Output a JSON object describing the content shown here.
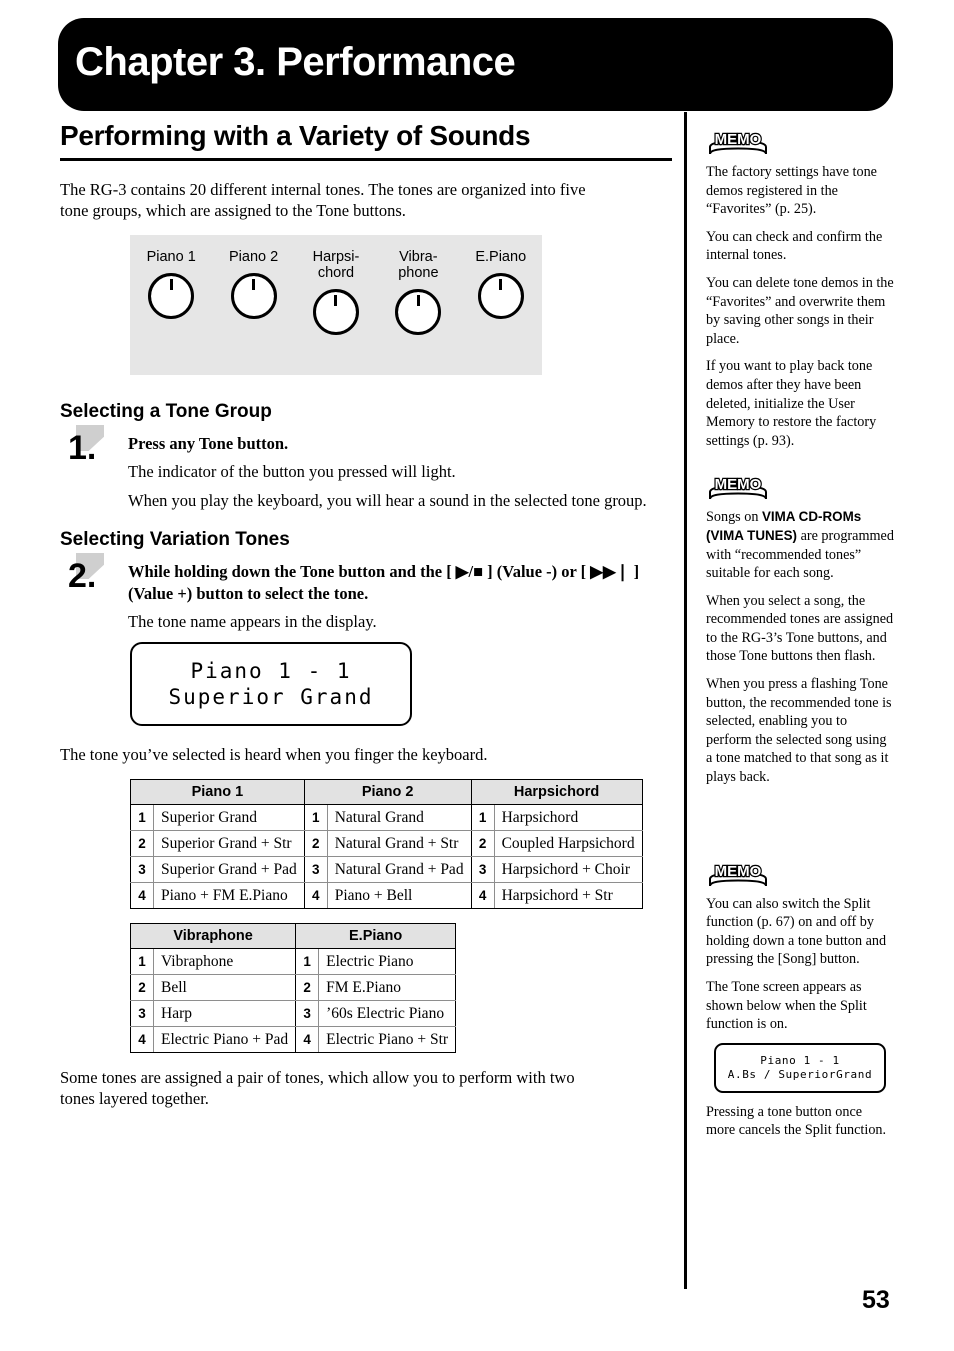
{
  "chapter": {
    "title": "Chapter 3. Performance"
  },
  "section": {
    "title": "Performing with a Variety of Sounds",
    "intro": "The RG-3 contains 20 different internal tones. The tones are organized into five tone groups, which are assigned to the Tone buttons."
  },
  "panel": {
    "buttons": [
      {
        "label": "Piano 1"
      },
      {
        "label": "Piano 2"
      },
      {
        "label": "Harpsi-\nchord"
      },
      {
        "label": "Vibra-\nphone"
      },
      {
        "label": "E.Piano"
      }
    ]
  },
  "subsections": {
    "tone_group": {
      "title": "Selecting a Tone Group"
    },
    "variation": {
      "title": "Selecting Variation Tones"
    }
  },
  "steps": [
    {
      "num": "1.",
      "head": "Press any Tone button.",
      "lines": [
        "The indicator of the button you pressed will light.",
        "When you play the keyboard, you will hear a sound in the selected tone group."
      ]
    },
    {
      "num": "2.",
      "head": "While holding down the Tone button and the [ ▶/■ ] (Value -) or [ ▶▶❘ ] (Value +) button to select the tone.",
      "lines": [
        "The tone name appears in the display."
      ]
    }
  ],
  "lcd_main": {
    "line1": "Piano 1 - 1",
    "line2": "Superior Grand"
  },
  "after_lcd_text": "The tone you’ve selected is heard when you finger the keyboard.",
  "tables": [
    {
      "columns": [
        {
          "header": "Piano 1",
          "rows": [
            {
              "index": "1",
              "name": "Superior Grand"
            },
            {
              "index": "2",
              "name": "Superior Grand + Str"
            },
            {
              "index": "3",
              "name": "Superior Grand + Pad"
            },
            {
              "index": "4",
              "name": "Piano + FM E.Piano"
            }
          ]
        },
        {
          "header": "Piano 2",
          "rows": [
            {
              "index": "1",
              "name": "Natural Grand"
            },
            {
              "index": "2",
              "name": "Natural Grand + Str"
            },
            {
              "index": "3",
              "name": "Natural Grand + Pad"
            },
            {
              "index": "4",
              "name": "Piano + Bell"
            }
          ]
        },
        {
          "header": "Harpsichord",
          "rows": [
            {
              "index": "1",
              "name": "Harpsichord"
            },
            {
              "index": "2",
              "name": "Coupled Harpsichord"
            },
            {
              "index": "3",
              "name": "Harpsichord + Choir"
            },
            {
              "index": "4",
              "name": "Harpsichord + Str"
            }
          ]
        }
      ]
    },
    {
      "columns": [
        {
          "header": "Vibraphone",
          "rows": [
            {
              "index": "1",
              "name": "Vibraphone"
            },
            {
              "index": "2",
              "name": "Bell"
            },
            {
              "index": "3",
              "name": "Harp"
            },
            {
              "index": "4",
              "name": "Electric Piano + Pad"
            }
          ]
        },
        {
          "header": "E.Piano",
          "rows": [
            {
              "index": "1",
              "name": "Electric Piano"
            },
            {
              "index": "2",
              "name": "FM E.Piano"
            },
            {
              "index": "3",
              "name": "’60s Electric Piano"
            },
            {
              "index": "4",
              "name": "Electric Piano + Str"
            }
          ]
        }
      ]
    }
  ],
  "closing_text": "Some tones are assigned a pair of tones, which allow you to perform with two tones layered together.",
  "memos": [
    {
      "icon": "memo-icon",
      "label": "MEMO",
      "paragraphs": [
        "The factory settings have tone demos registered in the “Favorites” (p. 25).",
        "You can check and confirm the internal tones.",
        "You can delete tone demos in the “Favorites” and overwrite them by saving other songs in their place.",
        "If you want to play back tone demos after they have been deleted, initialize the User Memory to restore the factory settings (p. 93)."
      ]
    },
    {
      "icon": "memo-icon",
      "label": "MEMO",
      "paragraphs": [
        "Songs on VIMA CD-ROMs (VIMA TUNES) are programmed with “recommended tones” suitable for each song.",
        "When you select a song, the recommended tones are assigned to the RG-3’s Tone buttons, and those Tone buttons then flash.",
        "When you press a flashing Tone button, the recommended tone is selected, enabling you to perform the selected song using a tone matched to that song as it plays back."
      ],
      "bold_runs": [
        "VIMA CD-ROMs",
        "(VIMA TUNES)"
      ]
    },
    {
      "icon": "memo-icon",
      "label": "MEMO",
      "paragraphs": [
        "You can also switch the Split function (p. 67) on and off by holding down a tone button and pressing the [Song] button.",
        "The Tone screen appears as shown below when the Split function is on."
      ]
    }
  ],
  "lcd_split": {
    "line1": "Piano 1 - 1",
    "line2": "A.Bs / SuperiorGrand"
  },
  "memo_split_after": "Pressing a tone button once more cancels the Split function.",
  "page_number": "53",
  "colors": {
    "banner": "#000000",
    "panel_bg": "#e6e6e6",
    "table_header_bg": "#e2e2e2",
    "step_shadow": "#cfcfcf"
  }
}
